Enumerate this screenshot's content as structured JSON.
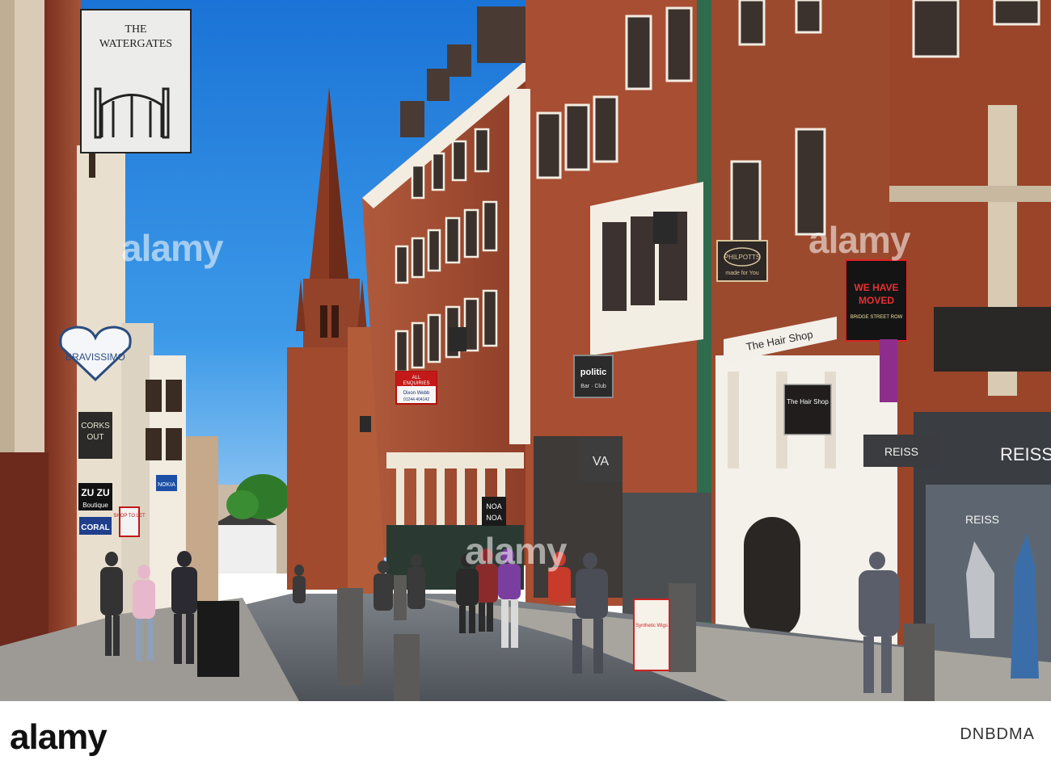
{
  "image": {
    "kind": "photograph",
    "scene": "street",
    "colors": {
      "sky": "#2f8fe0",
      "brick": "#9c4a2e",
      "cobbles": "#6c7178",
      "stone": "#efe8da"
    }
  },
  "signs": {
    "watergates_line1": "THE",
    "watergates_line2": "WATERGATES",
    "bravissimo": "BRAVISSIMO",
    "corks_out_1": "CORKS",
    "corks_out_2": "OUT",
    "zu_zu": "ZU ZU",
    "boutique": "Boutique",
    "coral": "CORAL",
    "shop_to_let": "SHOP TO LET",
    "nokia": "NOKIA",
    "all_enquiries_1": "ALL",
    "all_enquiries_2": "ENQUIRIES",
    "agent_name": "Dixon Webb",
    "agent_phone": "01244 404142",
    "politic": "politic",
    "politic_sub": "Bar · Club",
    "va": "VA",
    "noa_line1": "NOA",
    "noa_line2": "NOA",
    "philpotts": "PHILPOTTS",
    "philpotts_sub": "made for You",
    "hair_shop": "The Hair Shop",
    "hair_shop_sign": "The Hair Shop",
    "we_have_1": "WE HAVE",
    "we_have_2": "MOVED",
    "we_have_3": "BRIDGE STREET ROW",
    "reiss_sign": "REISS",
    "reiss_fascia": "REISS",
    "reiss_window": "REISS",
    "wigs_board": "Synthetic Wigs"
  },
  "watermark": {
    "text": "alamy"
  },
  "footer": {
    "logo": "alamy",
    "image_id": "DNBDMA"
  }
}
